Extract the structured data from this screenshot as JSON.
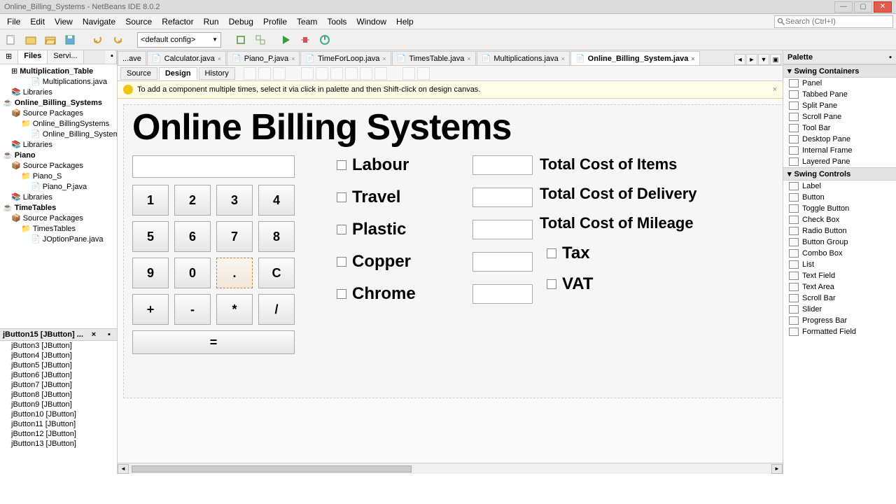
{
  "window_title": "Online_Billing_Systems - NetBeans IDE 8.0.2",
  "menu": [
    "File",
    "Edit",
    "View",
    "Navigate",
    "Source",
    "Refactor",
    "Run",
    "Debug",
    "Profile",
    "Team",
    "Tools",
    "Window",
    "Help"
  ],
  "search_placeholder": "Search (Ctrl+I)",
  "toolbar_config": "<default config>",
  "left_tabs": {
    "projects_icon": "P",
    "files": "Files",
    "services": "Servi..."
  },
  "project_tree": {
    "root0": "Multiplication_Table",
    "root0_file": "Multiplications.java",
    "root0_lib": "Libraries",
    "root1": "Online_Billing_Systems",
    "root1_src": "Source Packages",
    "root1_pkg": "Online_BillingSystems",
    "root1_file": "Online_Billing_System",
    "root1_lib": "Libraries",
    "root2": "Piano",
    "root2_src": "Source Packages",
    "root2_pkg": "Piano_S",
    "root2_file": "Piano_P.java",
    "root2_lib": "Libraries",
    "root3": "TimeTables",
    "root3_src": "Source Packages",
    "root3_pkg": "TimesTables",
    "root3_file": "JOptionPane.java"
  },
  "navigator_title": "jButton15 [JButton] ...",
  "navigator_items": [
    "jButton3 [JButton]",
    "jButton4 [JButton]",
    "jButton5 [JButton]",
    "jButton6 [JButton]",
    "jButton7 [JButton]",
    "jButton8 [JButton]",
    "jButton9 [JButton]",
    "jButton10 [JButton]",
    "jButton11 [JButton]",
    "jButton12 [JButton]",
    "jButton13 [JButton]"
  ],
  "editor_tabs": [
    "...ave",
    "Calculator.java",
    "Piano_P.java",
    "TimeForLoop.java",
    "TimesTable.java",
    "Multiplications.java",
    "Online_Billing_System.java"
  ],
  "design_tabs": {
    "source": "Source",
    "design": "Design",
    "history": "History"
  },
  "tip_text": "To add a component multiple times, select it via click in palette and then Shift-click on design canvas.",
  "form": {
    "title": "Online Billing Systems",
    "keys": [
      "1",
      "2",
      "3",
      "4",
      "5",
      "6",
      "7",
      "8",
      "9",
      "0",
      ".",
      "C",
      "+",
      "-",
      "*",
      "/"
    ],
    "equals": "=",
    "checkboxes": [
      "Labour",
      "Travel",
      "Plastic",
      "Copper",
      "Chrome"
    ],
    "totals": [
      "Total Cost of Items",
      "Total Cost of Delivery",
      "Total Cost of Mileage"
    ],
    "taxes": [
      "Tax",
      "VAT"
    ]
  },
  "palette": {
    "title": "Palette",
    "cat1": "Swing Containers",
    "containers": [
      "Panel",
      "Tabbed Pane",
      "Split Pane",
      "Scroll Pane",
      "Tool Bar",
      "Desktop Pane",
      "Internal Frame",
      "Layered Pane"
    ],
    "cat2": "Swing Controls",
    "controls": [
      "Label",
      "Button",
      "Toggle Button",
      "Check Box",
      "Radio Button",
      "Button Group",
      "Combo Box",
      "List",
      "Text Field",
      "Text Area",
      "Scroll Bar",
      "Slider",
      "Progress Bar",
      "Formatted Field"
    ]
  }
}
